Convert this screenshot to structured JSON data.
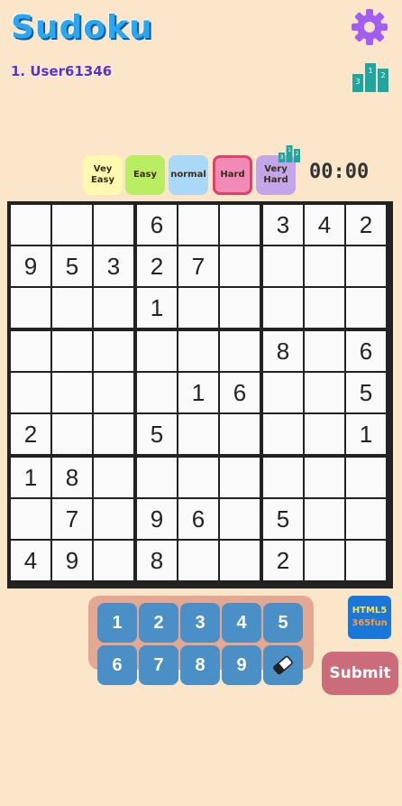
{
  "header": {
    "title": "Sudoku",
    "user": "1. User61346"
  },
  "rank_badge": [
    "3",
    "1",
    "2"
  ],
  "difficulty": [
    {
      "label": "Vey\nEasy",
      "color": "#fdfab0",
      "selected": false
    },
    {
      "label": "Easy",
      "color": "#b9ee63",
      "selected": false
    },
    {
      "label": "normal",
      "color": "#a9d9f7",
      "selected": false
    },
    {
      "label": "Hard",
      "color": "#f18ab5",
      "selected": true
    },
    {
      "label": "Very\nHard",
      "color": "#c3a6ea",
      "selected": false
    }
  ],
  "timer": "00:00",
  "grid": [
    [
      "",
      "",
      "",
      "6",
      "",
      "",
      "3",
      "4",
      "2"
    ],
    [
      "9",
      "5",
      "3",
      "2",
      "7",
      "",
      "",
      "",
      ""
    ],
    [
      "",
      "",
      "",
      "1",
      "",
      "",
      "",
      "",
      ""
    ],
    [
      "",
      "",
      "",
      "",
      "",
      "",
      "8",
      "",
      "6"
    ],
    [
      "",
      "",
      "",
      "",
      "1",
      "6",
      "",
      "",
      "5"
    ],
    [
      "2",
      "",
      "",
      "5",
      "",
      "",
      "",
      "",
      "1"
    ],
    [
      "1",
      "8",
      "",
      "",
      "",
      "",
      "",
      "",
      ""
    ],
    [
      "",
      "7",
      "",
      "9",
      "6",
      "",
      "5",
      "",
      ""
    ],
    [
      "4",
      "9",
      "",
      "8",
      "",
      "",
      "2",
      "",
      ""
    ]
  ],
  "keypad": [
    "1",
    "2",
    "3",
    "4",
    "5",
    "6",
    "7",
    "8",
    "9"
  ],
  "eraser_icon": "eraser-icon",
  "html5_badge": {
    "line1": "HTML5",
    "line2": "365fun"
  },
  "submit_label": "Submit",
  "colors": {
    "background": "#fbe6c9",
    "title": "#2aa6f2",
    "keypad_key": "#4a90c6",
    "submit": "#cc6b7a"
  }
}
